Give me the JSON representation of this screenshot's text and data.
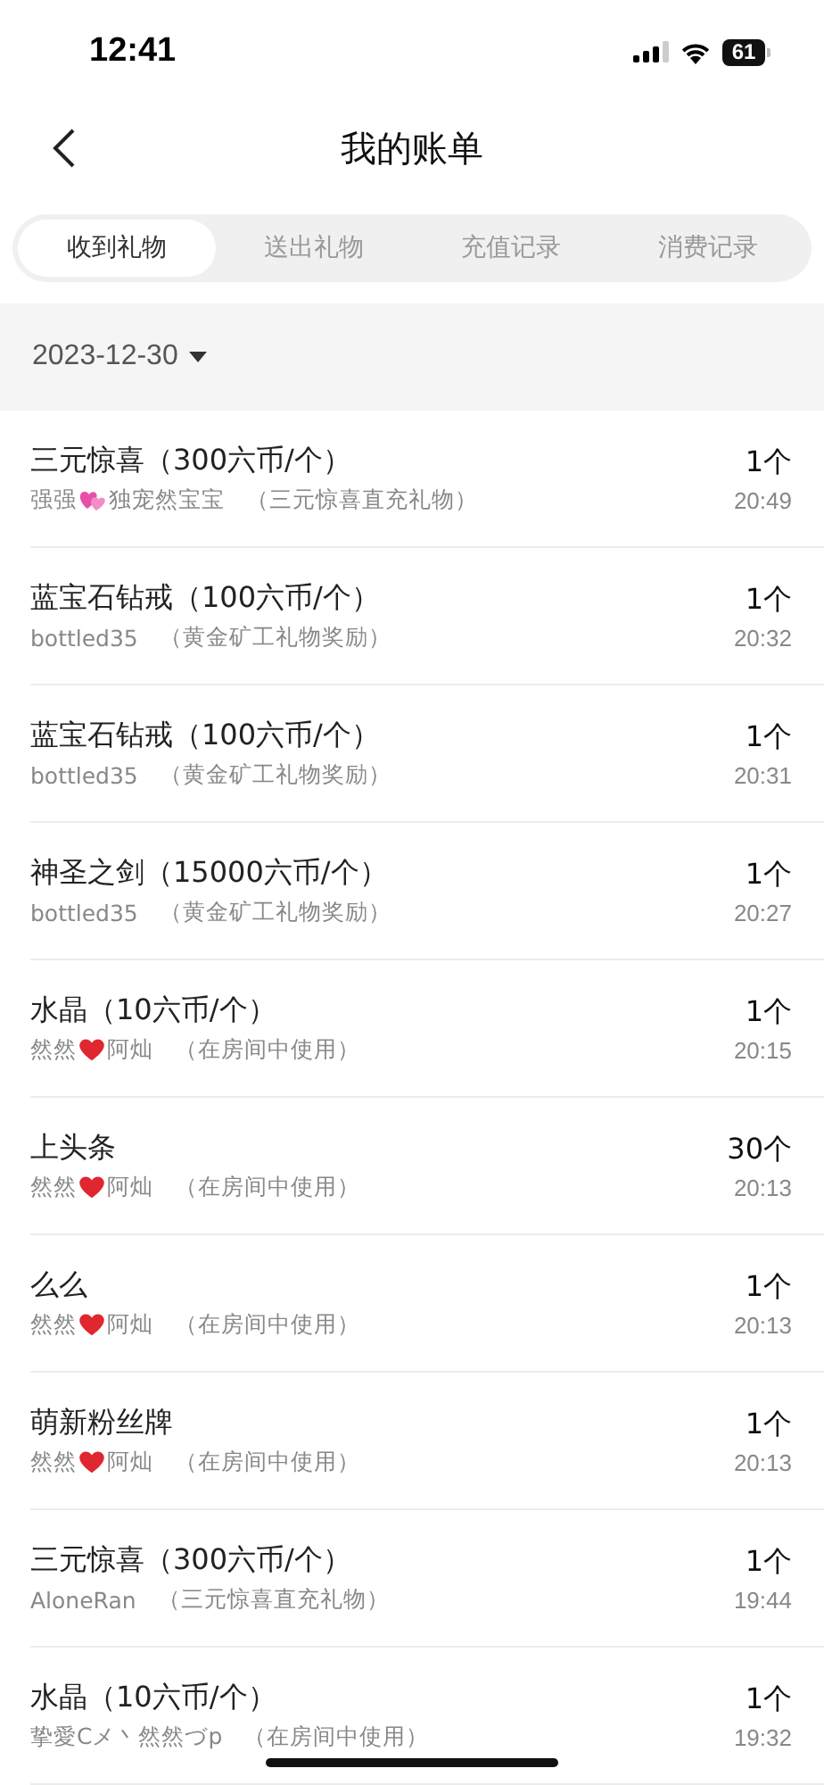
{
  "status_bar": {
    "time": "12:41",
    "battery": "61"
  },
  "nav": {
    "title": "我的账单"
  },
  "tabs": [
    {
      "label": "收到礼物",
      "selected": true
    },
    {
      "label": "送出礼物",
      "selected": false
    },
    {
      "label": "充值记录",
      "selected": false
    },
    {
      "label": "消费记录",
      "selected": false
    }
  ],
  "date_filter": {
    "value": "2023-12-30"
  },
  "records": [
    {
      "gift": "三元惊喜（300六币/个）",
      "kind": "hearts",
      "sender_before": "强强",
      "sender_after": "独宠然宝宝",
      "source": "（三元惊喜直充礼物）",
      "count": "1个",
      "time": "20:49"
    },
    {
      "gift": "蓝宝石钻戒（100六币/个）",
      "kind": "plain",
      "sender_before": "bottled35",
      "source": "（黄金矿工礼物奖励）",
      "count": "1个",
      "time": "20:32"
    },
    {
      "gift": "蓝宝石钻戒（100六币/个）",
      "kind": "plain",
      "sender_before": "bottled35",
      "source": "（黄金矿工礼物奖励）",
      "count": "1个",
      "time": "20:31"
    },
    {
      "gift": "神圣之剑（15000六币/个）",
      "kind": "plain",
      "sender_before": "bottled35",
      "source": "（黄金矿工礼物奖励）",
      "count": "1个",
      "time": "20:27"
    },
    {
      "gift": "水晶（10六币/个）",
      "kind": "heart",
      "sender_before": "然然",
      "sender_after": "阿灿",
      "source": "（在房间中使用）",
      "count": "1个",
      "time": "20:15"
    },
    {
      "gift": "上头条",
      "kind": "heart",
      "sender_before": "然然",
      "sender_after": "阿灿",
      "source": "（在房间中使用）",
      "count": "30个",
      "time": "20:13"
    },
    {
      "gift": "么么",
      "kind": "heart",
      "sender_before": "然然",
      "sender_after": "阿灿",
      "source": "（在房间中使用）",
      "count": "1个",
      "time": "20:13"
    },
    {
      "gift": "萌新粉丝牌",
      "kind": "heart",
      "sender_before": "然然",
      "sender_after": "阿灿",
      "source": "（在房间中使用）",
      "count": "1个",
      "time": "20:13"
    },
    {
      "gift": "三元惊喜（300六币/个）",
      "kind": "plain",
      "sender_before": "AloneRan",
      "source": "（三元惊喜直充礼物）",
      "count": "1个",
      "time": "19:44"
    },
    {
      "gift": "水晶（10六币/个）",
      "kind": "plain",
      "sender_before": "挚愛Cメ丶然然づp",
      "source": "（在房间中使用）",
      "count": "1个",
      "time": "19:32"
    }
  ]
}
